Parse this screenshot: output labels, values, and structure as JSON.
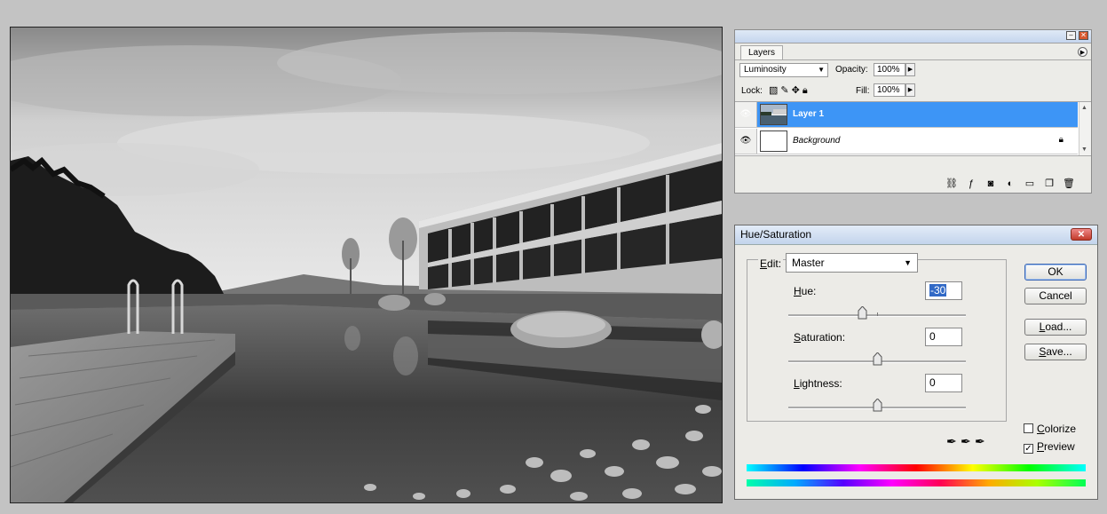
{
  "layers_panel": {
    "tab_label": "Layers",
    "blend_mode": "Luminosity",
    "opacity_label": "Opacity:",
    "opacity_value": "100%",
    "lock_label": "Lock:",
    "fill_label": "Fill:",
    "fill_value": "100%",
    "layers": [
      {
        "name": "Layer 1",
        "selected": true,
        "visible": true
      },
      {
        "name": "Background",
        "selected": false,
        "visible": true,
        "locked": true
      }
    ],
    "footer_icons": [
      "link-icon",
      "layer-style-icon",
      "mask-icon",
      "adjustment-icon",
      "folder-icon",
      "new-layer-icon",
      "trash-icon"
    ]
  },
  "hue_dialog": {
    "title": "Hue/Saturation",
    "edit_label": "Edit:",
    "edit_value": "Master",
    "hue_label": "Hue:",
    "hue_value": "-30",
    "saturation_label": "Saturation:",
    "saturation_value": "0",
    "lightness_label": "Lightness:",
    "lightness_value": "0",
    "hue_slider_fraction": 0.417,
    "saturation_slider_fraction": 0.5,
    "lightness_slider_fraction": 0.5,
    "ok_label": "OK",
    "cancel_label": "Cancel",
    "load_label": "Load...",
    "save_label": "Save...",
    "colorize_label": "Colorize",
    "colorize_checked": false,
    "preview_label": "Preview",
    "preview_checked": true
  },
  "colors": {
    "selection_blue": "#3d95f6",
    "close_red": "#c23a2a"
  }
}
